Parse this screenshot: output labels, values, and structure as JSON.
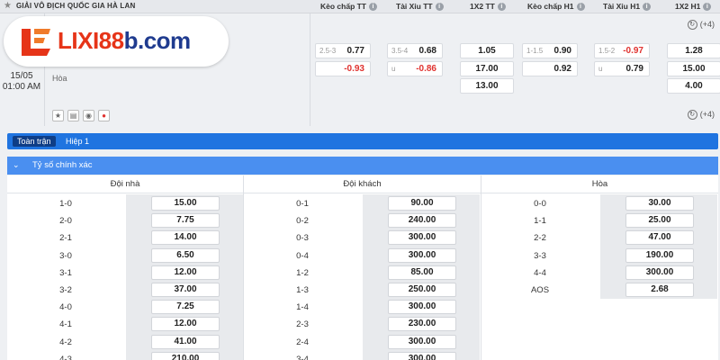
{
  "header": {
    "league": "GIẢI VÔ ĐỊCH QUỐC GIA HÀ LAN",
    "columns": [
      "Kèo chấp TT",
      "Tài Xỉu TT",
      "1X2 TT",
      "Kèo chấp H1",
      "Tài Xỉu H1",
      "1X2 H1"
    ],
    "info_glyph": "i"
  },
  "logo": {
    "text_main": "LIXI88",
    "text_suffix": "b.com"
  },
  "match": {
    "date": "15/05",
    "time": "01:00 AM",
    "draw_label": "Hòa",
    "more_top": "(+4)",
    "more_bottom": "(+4)",
    "odds": {
      "hcp_tt": {
        "line": "2.5-3",
        "home": "0.77",
        "away": "-0.93"
      },
      "ou_tt": {
        "line": "3.5-4",
        "over": "0.68",
        "under_label": "u",
        "under": "-0.86"
      },
      "x12_tt": [
        "1.05",
        "17.00",
        "13.00"
      ],
      "hcp_h1": {
        "line": "1-1.5",
        "home": "0.90",
        "away": "0.92"
      },
      "ou_h1": {
        "line": "1.5-2",
        "over": "-0.97",
        "under_label": "u",
        "under": "0.79"
      },
      "x12_h1": [
        "1.28",
        "15.00",
        "4.00"
      ]
    }
  },
  "tabs": {
    "full": "Toàn trận",
    "half": "Hiệp 1"
  },
  "section": {
    "title": "Tỷ số chính xác"
  },
  "table": {
    "headers": [
      "Đội nhà",
      "Đội khách",
      "Hòa"
    ],
    "home": [
      [
        "1-0",
        "15.00"
      ],
      [
        "2-0",
        "7.75"
      ],
      [
        "2-1",
        "14.00"
      ],
      [
        "3-0",
        "6.50"
      ],
      [
        "3-1",
        "12.00"
      ],
      [
        "3-2",
        "37.00"
      ],
      [
        "4-0",
        "7.25"
      ],
      [
        "4-1",
        "12.00"
      ],
      [
        "4-2",
        "41.00"
      ],
      [
        "4-3",
        "210.00"
      ]
    ],
    "away": [
      [
        "0-1",
        "90.00"
      ],
      [
        "0-2",
        "240.00"
      ],
      [
        "0-3",
        "300.00"
      ],
      [
        "0-4",
        "300.00"
      ],
      [
        "1-2",
        "85.00"
      ],
      [
        "1-3",
        "250.00"
      ],
      [
        "1-4",
        "300.00"
      ],
      [
        "2-3",
        "230.00"
      ],
      [
        "2-4",
        "300.00"
      ],
      [
        "3-4",
        "300.00"
      ]
    ],
    "draw": [
      [
        "0-0",
        "30.00"
      ],
      [
        "1-1",
        "25.00"
      ],
      [
        "2-2",
        "47.00"
      ],
      [
        "3-3",
        "190.00"
      ],
      [
        "4-4",
        "300.00"
      ],
      [
        "AOS",
        "2.68"
      ]
    ]
  },
  "colors": {
    "accent": "#1f74e0",
    "section": "#4a8ff0",
    "negative": "#e0322f",
    "logo_red": "#e63418",
    "logo_blue": "#1f3b8f"
  }
}
